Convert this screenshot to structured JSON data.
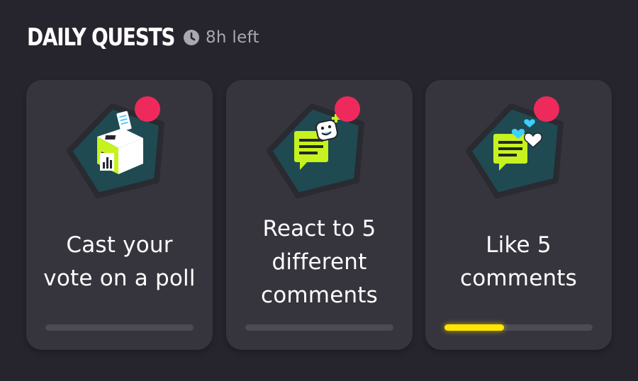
{
  "header": {
    "title": "DAILY QUESTS",
    "timer_text": "8h left",
    "clock_icon": "clock-icon"
  },
  "colors": {
    "background": "#26252e",
    "card": "#36353d",
    "badge_pentagon": "#1f4a52",
    "accent_green": "#c6f21f",
    "notification_dot": "#ee2a5c",
    "progress_fill": "#ffe600",
    "progress_track": "#4c4b54",
    "heart_blue": "#3fcfff"
  },
  "quests": [
    {
      "text": "Cast your vote on a poll",
      "line1": "Cast your",
      "line2": "vote on a poll",
      "icon": "ballot-box-icon",
      "progress": 0
    },
    {
      "text": "React to 5 different comments",
      "line1": "React to 5",
      "line2": "different",
      "line3": "comments",
      "icon": "react-comment-icon",
      "progress": 0
    },
    {
      "text": "Like 5 comments",
      "line1": "Like 5",
      "line2": "comments",
      "icon": "like-comment-icon",
      "progress": 0.4
    }
  ]
}
